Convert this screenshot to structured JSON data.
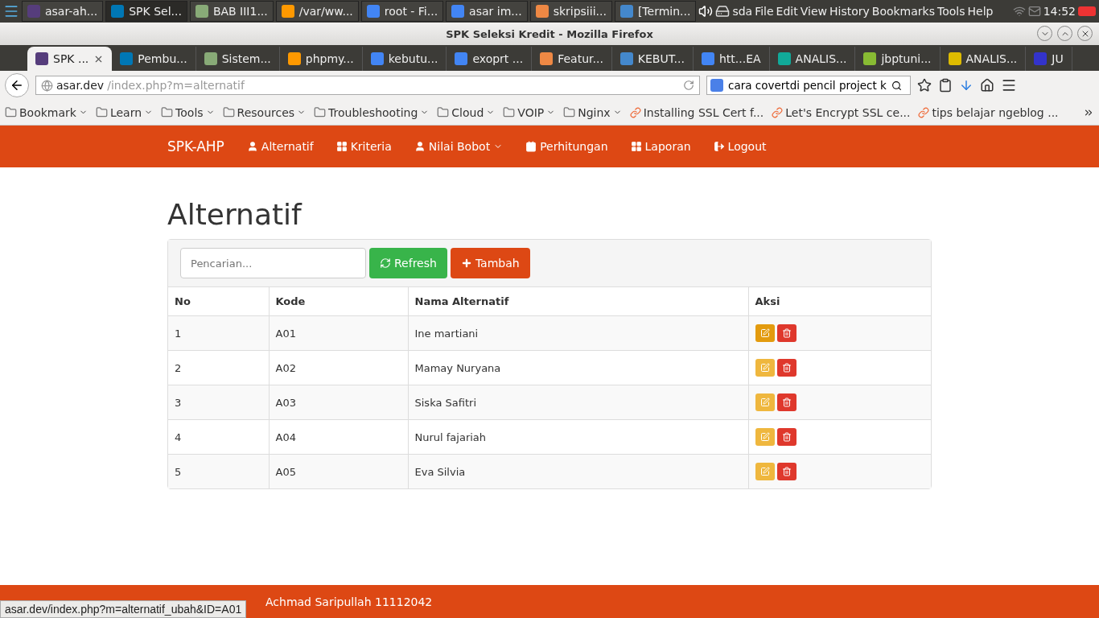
{
  "system_panel": {
    "taskbar": [
      {
        "label": "asar-ah...",
        "selected": false
      },
      {
        "label": "SPK Sel...",
        "selected": true
      },
      {
        "label": "BAB III1...",
        "selected": false
      },
      {
        "label": "/var/ww...",
        "selected": false
      },
      {
        "label": "root - Fi...",
        "selected": false
      },
      {
        "label": "asar im...",
        "selected": false
      },
      {
        "label": "skripsiii...",
        "selected": false
      },
      {
        "label": "[Termin...",
        "selected": false
      }
    ],
    "device": "sda",
    "menu": [
      "File",
      "Edit",
      "View",
      "History",
      "Bookmarks",
      "Tools",
      "Help"
    ],
    "clock": "14:52"
  },
  "window": {
    "title": "SPK Seleksi Kredit - Mozilla Firefox"
  },
  "tabs": [
    {
      "label": "SPK ...",
      "selected": true
    },
    {
      "label": "Pembu...",
      "selected": false
    },
    {
      "label": "Sistem...",
      "selected": false
    },
    {
      "label": "phpmy...",
      "selected": false
    },
    {
      "label": "kebutu...",
      "selected": false
    },
    {
      "label": "exoprt ...",
      "selected": false
    },
    {
      "label": "Featur...",
      "selected": false
    },
    {
      "label": "KEBUT...",
      "selected": false
    },
    {
      "label": "htt...EA",
      "selected": false
    },
    {
      "label": "ANALIS...",
      "selected": false
    },
    {
      "label": "jbptuni...",
      "selected": false
    },
    {
      "label": "ANALIS...",
      "selected": false
    },
    {
      "label": "JU",
      "selected": false
    }
  ],
  "address": {
    "host": "asar.dev",
    "path": "/index.php?m=alternatif"
  },
  "search": {
    "value": "cara covertdi  pencil project  k"
  },
  "bookmarks": [
    {
      "label": "Bookmark",
      "kind": "folder"
    },
    {
      "label": "Learn",
      "kind": "folder"
    },
    {
      "label": "Tools",
      "kind": "folder"
    },
    {
      "label": "Resources",
      "kind": "folder"
    },
    {
      "label": "Troubleshooting",
      "kind": "folder"
    },
    {
      "label": "Cloud",
      "kind": "folder"
    },
    {
      "label": "VOIP",
      "kind": "folder"
    },
    {
      "label": "Nginx",
      "kind": "folder"
    },
    {
      "label": "Installing SSL Cert f...",
      "kind": "link"
    },
    {
      "label": "Let's Encrypt SSL ce...",
      "kind": "link"
    },
    {
      "label": "tips belajar ngeblog ...",
      "kind": "link"
    }
  ],
  "navbar": {
    "brand": "SPK-AHP",
    "items": [
      {
        "label": "Alternatif",
        "dropdown": false
      },
      {
        "label": "Kriteria",
        "dropdown": false
      },
      {
        "label": "Nilai Bobot",
        "dropdown": true
      },
      {
        "label": "Perhitungan",
        "dropdown": false
      },
      {
        "label": "Laporan",
        "dropdown": false
      },
      {
        "label": "Logout",
        "dropdown": false
      }
    ]
  },
  "page": {
    "heading": "Alternatif",
    "search_placeholder": "Pencarian...",
    "refresh": "Refresh",
    "add": "Tambah",
    "columns": [
      "No",
      "Kode",
      "Nama Alternatif",
      "Aksi"
    ],
    "rows": [
      {
        "no": "1",
        "code": "A01",
        "name": "Ine martiani",
        "edit_hovered": true
      },
      {
        "no": "2",
        "code": "A02",
        "name": "Mamay Nuryana",
        "edit_hovered": false
      },
      {
        "no": "3",
        "code": "A03",
        "name": "Siska Safitri",
        "edit_hovered": false
      },
      {
        "no": "4",
        "code": "A04",
        "name": "Nurul fajariah",
        "edit_hovered": false
      },
      {
        "no": "5",
        "code": "A05",
        "name": "Eva Silvia",
        "edit_hovered": false
      }
    ]
  },
  "footer": {
    "text": "Achmad Saripullah 11112042"
  },
  "status_url": "asar.dev/index.php?m=alternatif_ubah&ID=A01"
}
